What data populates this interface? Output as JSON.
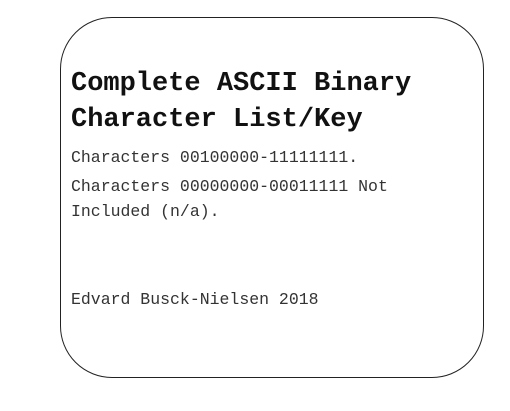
{
  "document": {
    "title_line1": "Complete ASCII Binary",
    "title_line2": "Character List/Key",
    "range_included": "Characters 00100000-11111111.",
    "range_excluded_line1": "Characters 00000000-00011111 Not",
    "range_excluded_line2": "Included (n/a).",
    "author": "Edvard Busck-Nielsen 2018"
  }
}
